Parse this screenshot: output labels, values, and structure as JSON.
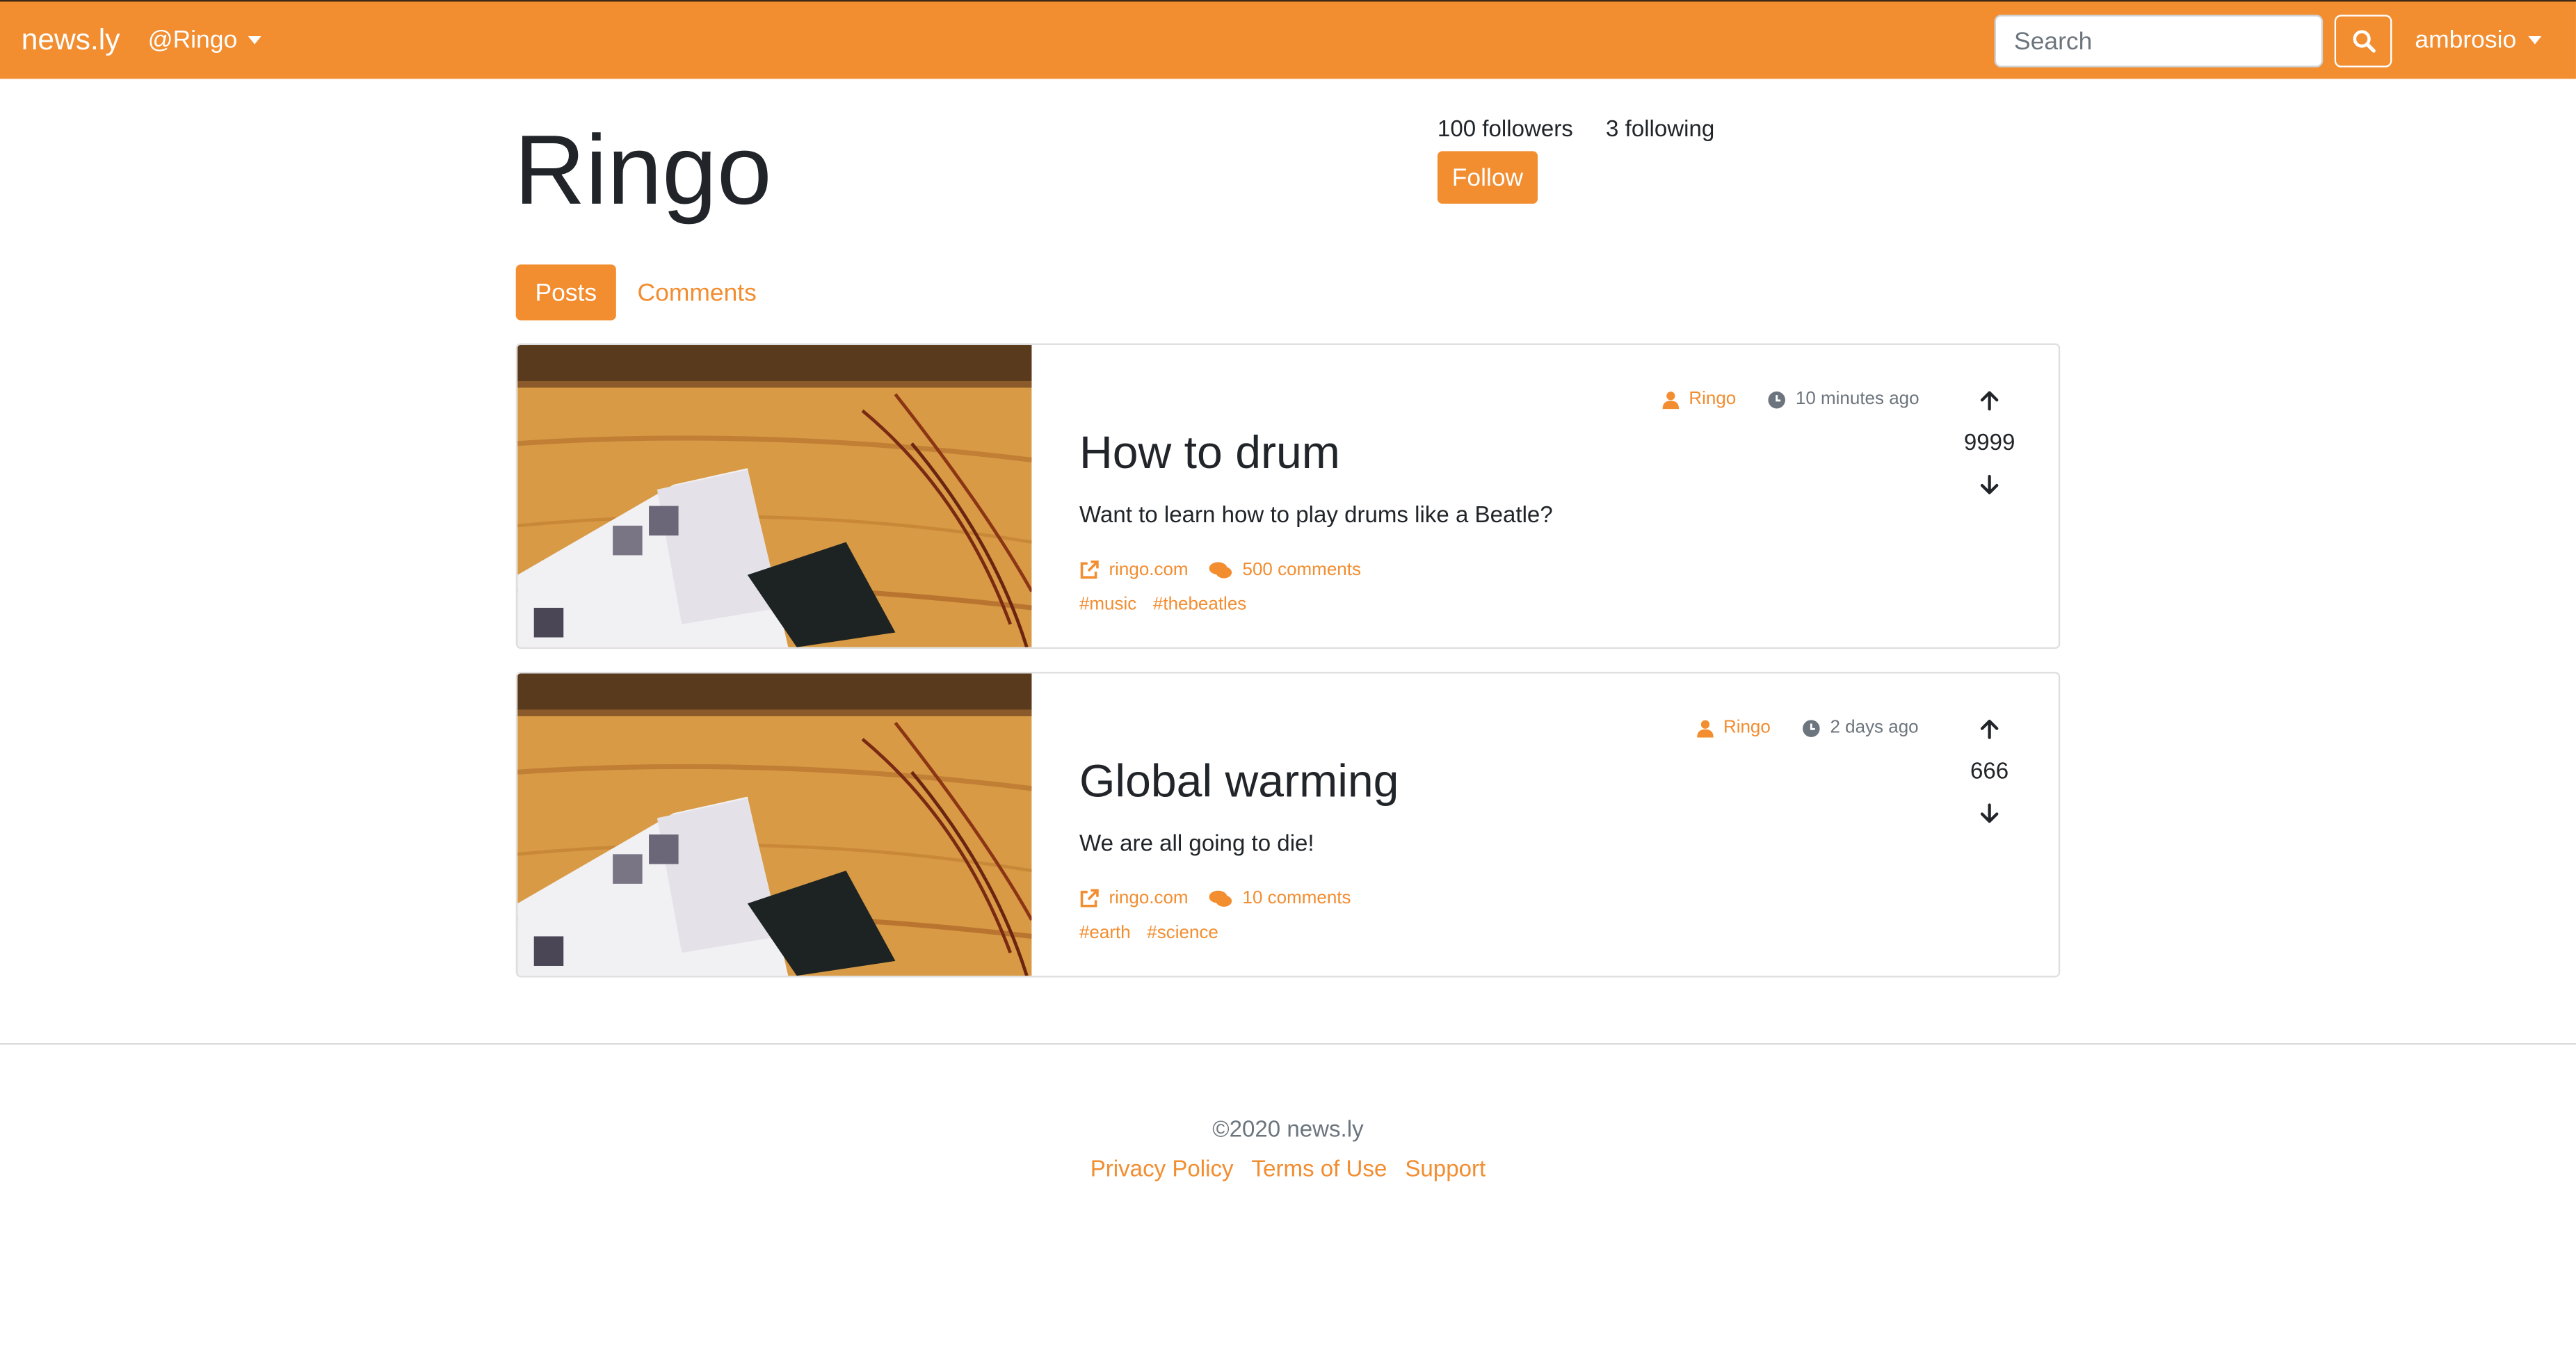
{
  "navbar": {
    "brand": "news.ly",
    "profile_menu_label": "@Ringo",
    "search_placeholder": "Search",
    "account_label": "ambrosio"
  },
  "profile": {
    "name": "Ringo",
    "followers": "100 followers",
    "following": "3 following",
    "follow_label": "Follow"
  },
  "tabs": [
    {
      "label": "Posts",
      "active": true
    },
    {
      "label": "Comments",
      "active": false
    }
  ],
  "posts": [
    {
      "author": "Ringo",
      "time": "10 minutes ago",
      "title": "How to drum",
      "summary": "Want to learn how to play drums like a Beatle?",
      "source": "ringo.com",
      "comments": "500 comments",
      "tags": [
        "#music",
        "#thebeatles"
      ],
      "score": "9999"
    },
    {
      "author": "Ringo",
      "time": "2 days ago",
      "title": "Global warming",
      "summary": "We are all going to die!",
      "source": "ringo.com",
      "comments": "10 comments",
      "tags": [
        "#earth",
        "#science"
      ],
      "score": "666"
    }
  ],
  "footer": {
    "copyright": "©2020 news.ly",
    "links": [
      "Privacy Policy",
      "Terms of Use",
      "Support"
    ]
  },
  "colors": {
    "accent": "#f28d30",
    "text": "#212529",
    "muted": "#6c757d"
  },
  "icons": {
    "search": "search-icon",
    "caret": "caret-down-icon",
    "author": "user-icon",
    "time": "clock-icon",
    "source": "external-link-icon",
    "comments": "comments-icon",
    "upvote": "arrow-up-icon",
    "downvote": "arrow-down-icon"
  }
}
